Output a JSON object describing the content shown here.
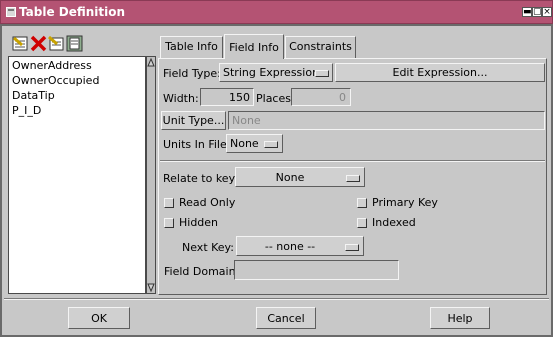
{
  "window": {
    "title": "Table Definition",
    "title_bar_color": "#b45373"
  },
  "toolbar": {
    "icons": [
      "add-field-icon",
      "delete-field-icon",
      "insert-field-icon",
      "table-view-icon"
    ]
  },
  "field_list": {
    "items": [
      "OwnerAddress",
      "OwnerOccupied",
      "DataTip",
      "P_I_D"
    ]
  },
  "tabs": [
    "Table Info",
    "Field Info",
    "Constraints"
  ],
  "active_tab": "Field Info",
  "field_info": {
    "field_type_label": "Field Type:",
    "field_type_value": "String Expression",
    "edit_expression_label": "Edit Expression...",
    "width_label": "Width:",
    "width_value": "150",
    "places_label": "Places:",
    "places_value": "0",
    "unit_type_button": "Unit Type...",
    "unit_type_value": "None",
    "units_in_file_label": "Units In File:",
    "units_in_file_value": "None",
    "relate_label": "Relate to key:",
    "relate_value": "None",
    "read_only_label": "Read Only",
    "primary_key_label": "Primary Key",
    "hidden_label": "Hidden",
    "indexed_label": "Indexed",
    "next_key_label": "Next Key:",
    "next_key_value": "-- none --",
    "field_domain_label": "Field Domain:",
    "field_domain_value": ""
  },
  "buttons": {
    "ok": "OK",
    "cancel": "Cancel",
    "help": "Help"
  }
}
